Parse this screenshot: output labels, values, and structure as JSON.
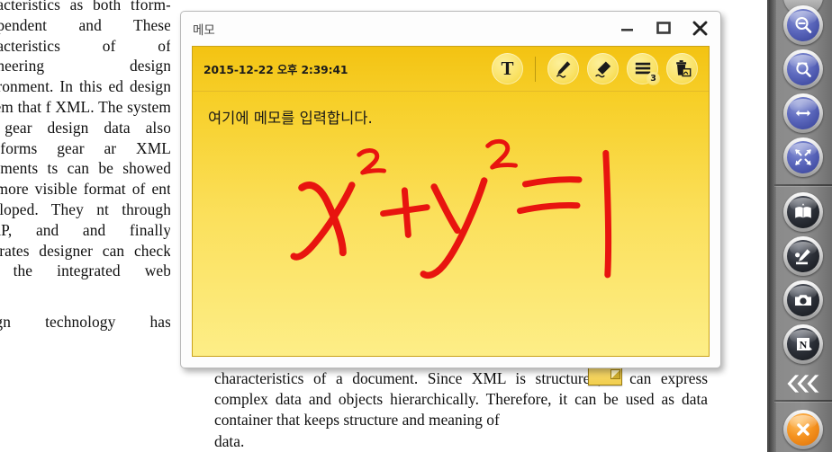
{
  "document": {
    "left_column_paragraph_1": "characteristics as both tform-independent and These characteristics of of engineering design environment.  In this ed design system that f XML.  The system om gear design data also transforms gear ar XML documents ts can be showed not more visible format of ent developed.  They nt through SOAP, and and finally generates designer can check the the integrated web",
    "left_column_paragraph_2": "design technology has",
    "bottom_paragraph": "characteristics of a document.  Since XML is structured, it can express complex data and objects hierarchically.  Therefore, it can be used as data container that keeps structure and meaning of",
    "bottom_last_line": "data.",
    "inline_note_marker": "sticky-note-marker"
  },
  "memo_window": {
    "title": "메모",
    "controls": {
      "minimize": "minimize-icon",
      "maximize": "maximize-icon",
      "close": "close-icon"
    },
    "toolbar": {
      "timestamp": "2015-12-22 오후 2:39:41",
      "buttons": [
        {
          "name": "text-tool",
          "icon": "text-T-icon",
          "label": "T",
          "badge": null
        },
        {
          "name": "pen-tool",
          "icon": "pencil-icon",
          "label": "",
          "badge": null
        },
        {
          "name": "eraser-tool",
          "icon": "eraser-icon",
          "label": "",
          "badge": null
        },
        {
          "name": "list-tool",
          "icon": "lines-list-icon",
          "label": "",
          "badge": "3"
        },
        {
          "name": "delete-tool",
          "icon": "trash-can-icon",
          "label": "",
          "badge": null
        }
      ]
    },
    "note": {
      "text": "여기에 메모를 입력합니다.",
      "handwriting": "x² + y² = 1",
      "ink_color": "#e8140f",
      "background_top": "#f5c618",
      "background_bottom": "#fdee87"
    }
  },
  "sidebar": {
    "buttons": [
      {
        "name": "zoom-out-button",
        "icon": "magnifier-minus-icon",
        "style": "blue"
      },
      {
        "name": "zoom-select-button",
        "icon": "magnifier-select-icon",
        "style": "blue"
      },
      {
        "name": "fit-width-button",
        "icon": "arrows-horizontal-icon",
        "style": "blue"
      },
      {
        "name": "fit-page-button",
        "icon": "arrows-diagonal-icon",
        "style": "blue"
      },
      {
        "name": "book-view-button",
        "icon": "open-book-icon",
        "style": "dark"
      },
      {
        "name": "annotate-button",
        "icon": "pen-stamp-icon",
        "style": "dark"
      },
      {
        "name": "snapshot-button",
        "icon": "camera-icon",
        "style": "dark"
      },
      {
        "name": "note-button",
        "icon": "note-N-icon",
        "style": "dark"
      }
    ],
    "collapse": {
      "name": "collapse-sidebar-button",
      "icon": "triple-chevron-left-icon",
      "glyph": "❮❮❮"
    },
    "close": {
      "name": "close-sidebar-button",
      "icon": "close-circle-icon",
      "style": "orange"
    }
  }
}
